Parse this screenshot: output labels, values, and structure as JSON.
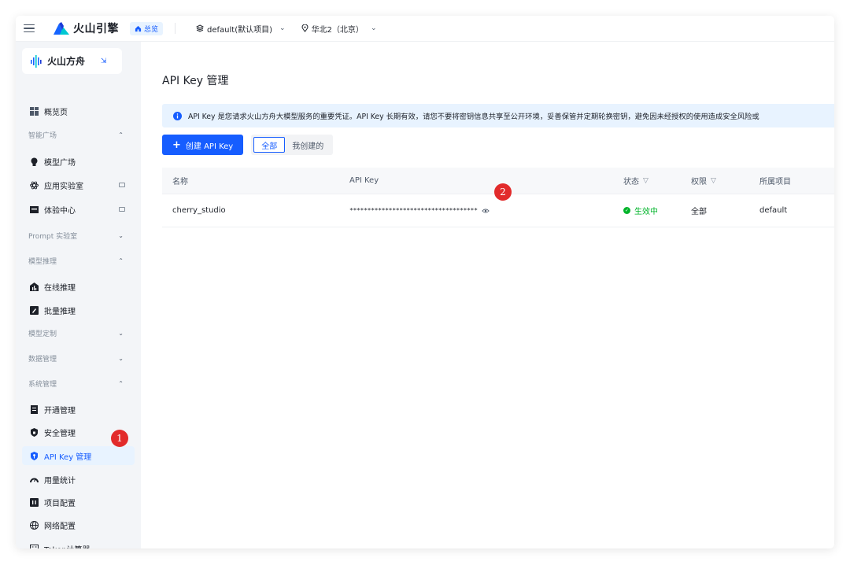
{
  "topbar": {
    "brand": "火山引擎",
    "overview": "总览",
    "project": "default(默认项目)",
    "region": "华北2（北京）"
  },
  "sidebar": {
    "product": "火山方舟",
    "items": [
      {
        "type": "item",
        "label": "概览页",
        "icon": "grid-icon"
      },
      {
        "type": "group",
        "label": "智能广场",
        "expanded": true
      },
      {
        "type": "item",
        "label": "模型广场",
        "icon": "bulb-icon"
      },
      {
        "type": "item",
        "label": "应用实验室",
        "icon": "atom-icon",
        "external": true
      },
      {
        "type": "item",
        "label": "体验中心",
        "icon": "box-icon",
        "external": true
      },
      {
        "type": "group",
        "label": "Prompt 实验室",
        "expanded": false
      },
      {
        "type": "group",
        "label": "模型推理",
        "expanded": true
      },
      {
        "type": "item",
        "label": "在线推理",
        "icon": "chart-icon"
      },
      {
        "type": "item",
        "label": "批量推理",
        "icon": "rocket-icon"
      },
      {
        "type": "group",
        "label": "模型定制",
        "expanded": false
      },
      {
        "type": "group",
        "label": "数据管理",
        "expanded": false
      },
      {
        "type": "group",
        "label": "系统管理",
        "expanded": true
      },
      {
        "type": "item",
        "label": "开通管理",
        "icon": "doc-icon"
      },
      {
        "type": "item",
        "label": "安全管理",
        "icon": "shield-icon"
      },
      {
        "type": "item",
        "label": "API Key 管理",
        "icon": "key-shield-icon",
        "active": true
      },
      {
        "type": "item",
        "label": "用量统计",
        "icon": "gauge-icon"
      },
      {
        "type": "item",
        "label": "项目配置",
        "icon": "folder-icon"
      },
      {
        "type": "item",
        "label": "网络配置",
        "icon": "globe-icon"
      },
      {
        "type": "item",
        "label": "Token计算器",
        "icon": "calculator-icon"
      }
    ]
  },
  "main": {
    "title": "API Key 管理",
    "alert": "API Key 是您请求火山方舟大模型服务的重要凭证。API Key 长期有效，请您不要将密钥信息共享至公开环境，妥善保管并定期轮换密钥，避免因未经授权的使用造成安全风险或",
    "create_button": "创建 API Key",
    "tabs": [
      "全部",
      "我创建的"
    ],
    "table": {
      "headers": [
        "名称",
        "API Key",
        "状态",
        "权限",
        "所属项目"
      ],
      "rows": [
        {
          "name": "cherry_studio",
          "key": "************************************",
          "status": "生效中",
          "permission": "全部",
          "project": "default"
        }
      ]
    }
  },
  "annotations": [
    "1",
    "2"
  ],
  "colors": {
    "accent": "#165dff",
    "active_bg": "#e8f3ff",
    "success": "#00b42a",
    "badge": "#e22b2b"
  }
}
